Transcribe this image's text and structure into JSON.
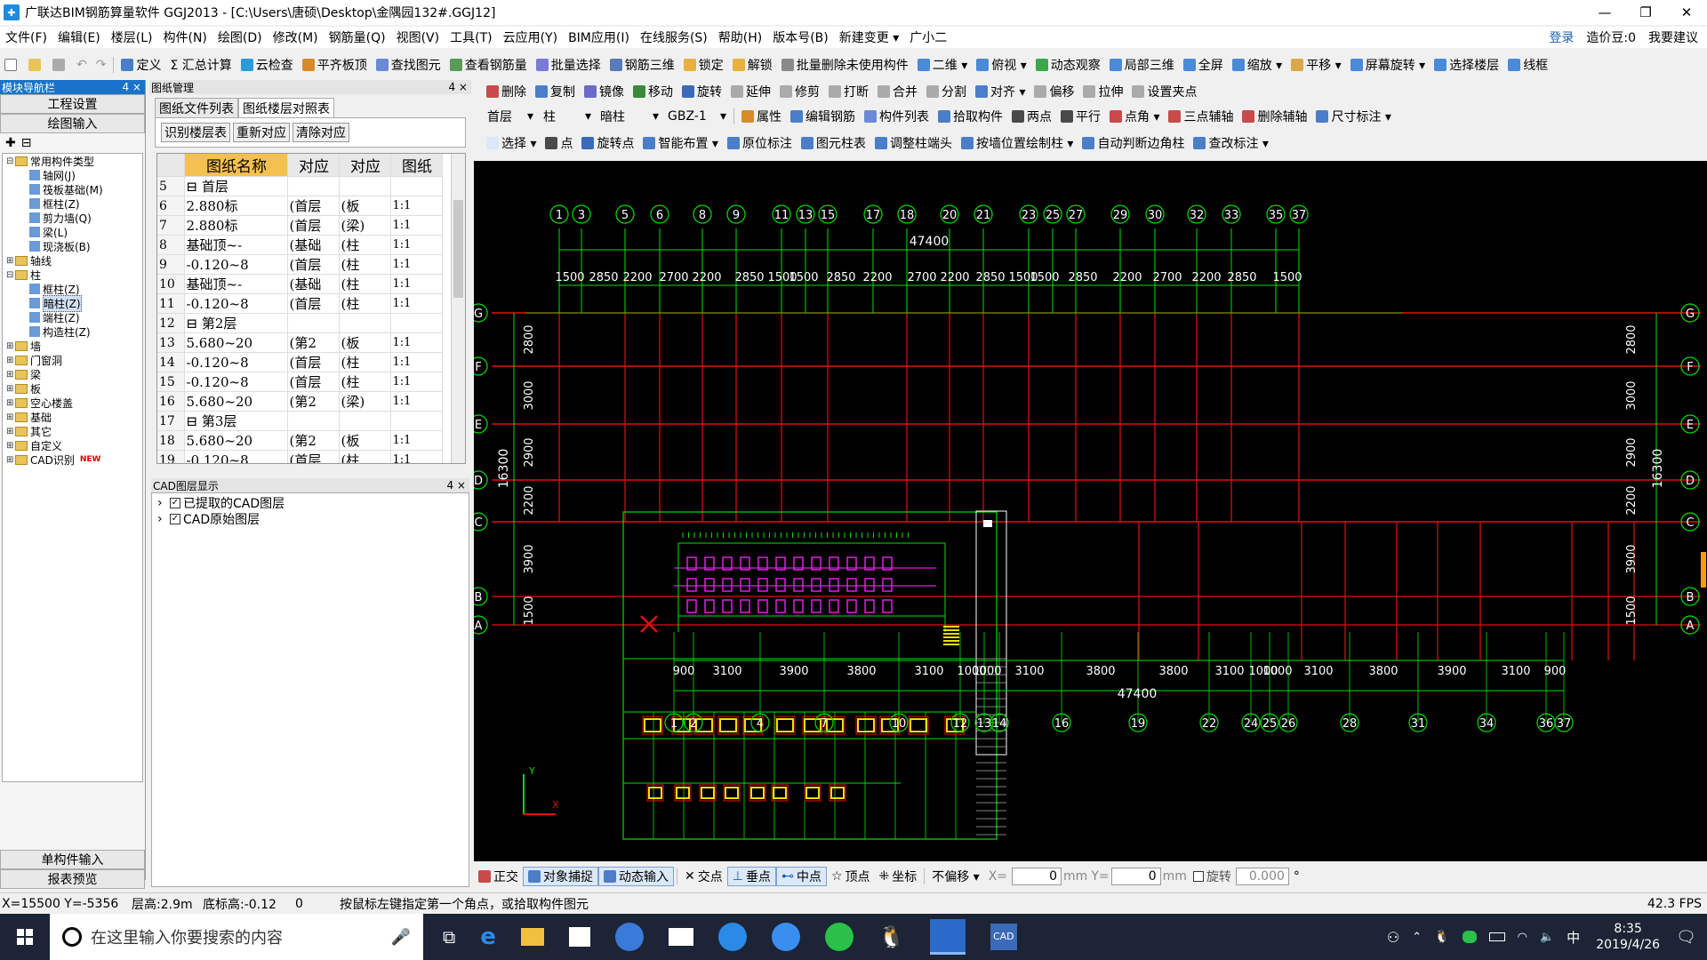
{
  "window": {
    "title": "广联达BIM钢筋算量软件 GGJ2013 - [C:\\Users\\唐硕\\Desktop\\金隅园132#.GGJ12]",
    "minimize": "—",
    "maximize": "❐",
    "close": "✕"
  },
  "menu": {
    "items": [
      "文件(F)",
      "编辑(E)",
      "楼层(L)",
      "构件(N)",
      "绘图(D)",
      "修改(M)",
      "钢筋量(Q)",
      "视图(V)",
      "工具(T)",
      "云应用(Y)",
      "BIM应用(I)",
      "在线服务(S)",
      "帮助(H)",
      "版本号(B)",
      "新建变更 ▾",
      "广小二"
    ],
    "login": "登录",
    "cost_beans": "造价豆:0",
    "suggest": "我要建议"
  },
  "toolbar1": [
    "定义",
    "Σ 汇总计算",
    "云检查",
    "平齐板顶",
    "查找图元",
    "查看钢筋量",
    "批量选择",
    "钢筋三维",
    "锁定",
    "解锁",
    "批量删除未使用构件",
    "二维 ▾",
    "俯视 ▾",
    "动态观察",
    "局部三维",
    "全屏",
    "缩放 ▾",
    "平移 ▾",
    "屏幕旋转 ▾",
    "选择楼层",
    "线框"
  ],
  "nav_panel": {
    "title": "模块导航栏",
    "pin": "4 ×",
    "buttons": [
      "工程设置",
      "绘图输入"
    ],
    "tree": [
      {
        "label": "常用构件类型",
        "level": 0,
        "type": "folder"
      },
      {
        "label": "轴网(J)",
        "level": 2,
        "type": "item"
      },
      {
        "label": "筏板基础(M)",
        "level": 2,
        "type": "item"
      },
      {
        "label": "框柱(Z)",
        "level": 2,
        "type": "item"
      },
      {
        "label": "剪力墙(Q)",
        "level": 2,
        "type": "item"
      },
      {
        "label": "梁(L)",
        "level": 2,
        "type": "item"
      },
      {
        "label": "现浇板(B)",
        "level": 2,
        "type": "item"
      },
      {
        "label": "轴线",
        "level": 0,
        "type": "folder"
      },
      {
        "label": "柱",
        "level": 0,
        "type": "folder"
      },
      {
        "label": "框柱(Z)",
        "level": 2,
        "type": "item"
      },
      {
        "label": "暗柱(Z)",
        "level": 2,
        "type": "item"
      },
      {
        "label": "端柱(Z)",
        "level": 2,
        "type": "item"
      },
      {
        "label": "构造柱(Z)",
        "level": 2,
        "type": "item"
      },
      {
        "label": "墙",
        "level": 0,
        "type": "folder"
      },
      {
        "label": "门窗洞",
        "level": 0,
        "type": "folder"
      },
      {
        "label": "梁",
        "level": 0,
        "type": "folder"
      },
      {
        "label": "板",
        "level": 0,
        "type": "folder"
      },
      {
        "label": "空心楼盖",
        "level": 0,
        "type": "folder"
      },
      {
        "label": "基础",
        "level": 0,
        "type": "folder"
      },
      {
        "label": "其它",
        "level": 0,
        "type": "folder"
      },
      {
        "label": "自定义",
        "level": 0,
        "type": "folder"
      },
      {
        "label": "CAD识别",
        "level": 0,
        "type": "folder",
        "badge": "NEW"
      }
    ],
    "bottom_buttons": [
      "单构件输入",
      "报表预览"
    ]
  },
  "drawing_panel": {
    "title": "图纸管理",
    "pin": "4 ×",
    "tabs": [
      "图纸文件列表",
      "图纸楼层对照表"
    ],
    "buttons": [
      "识别楼层表",
      "重新对应",
      "清除对应"
    ],
    "columns": [
      "图纸名称",
      "对应",
      "对应",
      "图纸"
    ],
    "rows": [
      [
        "5",
        "⊟ 首层",
        "",
        "",
        ""
      ],
      [
        "6",
        "  2.880标",
        "(首层",
        "(板",
        "1:1"
      ],
      [
        "7",
        "  2.880标",
        "(首层",
        "(梁)",
        "1:1"
      ],
      [
        "8",
        "  基础顶~-",
        "(基础",
        "(柱",
        "1:1"
      ],
      [
        "9",
        "  -0.120~8",
        "(首层",
        "(柱",
        "1:1"
      ],
      [
        "10",
        "  基础顶~-",
        "(基础",
        "(柱",
        "1:1"
      ],
      [
        "11",
        "  -0.120~8",
        "(首层",
        "(柱",
        "1:1"
      ],
      [
        "12",
        "⊟ 第2层",
        "",
        "",
        ""
      ],
      [
        "13",
        "  5.680~20",
        "(第2",
        "(板",
        "1:1"
      ],
      [
        "14",
        "  -0.120~8",
        "(首层",
        "(柱",
        "1:1"
      ],
      [
        "15",
        "  -0.120~8",
        "(首层",
        "(柱",
        "1:1"
      ],
      [
        "16",
        "  5.680~20",
        "(第2",
        "(梁)",
        "1:1"
      ],
      [
        "17",
        "⊟ 第3层",
        "",
        "",
        ""
      ],
      [
        "18",
        "  5.680~20",
        "(第2",
        "(板",
        "1:1"
      ],
      [
        "19",
        "  -0.120~8",
        "(首层",
        "(柱",
        "1:1"
      ],
      [
        "20",
        "  -0.120~8",
        "(首层",
        "(柱",
        "1:1"
      ],
      [
        "21",
        "  5.680~20",
        "(第2",
        "(梁)",
        "1:1"
      ]
    ]
  },
  "cad_layers": {
    "title": "CAD图层显示",
    "pin": "4 ×",
    "items": [
      "已提取的CAD图层",
      "CAD原始图层"
    ]
  },
  "edit_toolbar": [
    "删除",
    "复制",
    "镜像",
    "移动",
    "旋转",
    "延伸",
    "修剪",
    "打断",
    "合并",
    "分割",
    "对齐 ▾",
    "偏移",
    "拉伸",
    "设置夹点"
  ],
  "prop_toolbar": {
    "floor": "首层",
    "type": "柱",
    "subtype": "暗柱",
    "component": "GBZ-1",
    "buttons": [
      "属性",
      "编辑钢筋",
      "构件列表",
      "拾取构件",
      "两点",
      "平行",
      "点角 ▾",
      "三点辅轴",
      "删除辅轴",
      "尺寸标注 ▾"
    ]
  },
  "draw_toolbar": [
    "选择 ▾",
    "点",
    "旋转点",
    "智能布置 ▾",
    "原位标注",
    "图元柱表",
    "调整柱端头",
    "按墙位置绘制柱 ▾",
    "自动判断边角柱",
    "查改标注 ▾"
  ],
  "cad": {
    "top_axes": [
      "1",
      "3",
      "5",
      "6",
      "8",
      "9",
      "11",
      "13",
      "15",
      "17",
      "18",
      "20",
      "21",
      "23",
      "25",
      "27",
      "29",
      "30",
      "32",
      "33",
      "35",
      "37"
    ],
    "top_total": "47400",
    "top_dims": [
      "1500",
      "2850",
      "2200",
      "2700",
      "2200",
      "2850",
      "1500",
      "1500",
      "2850",
      "2200",
      "2700",
      "2200",
      "2850",
      "1500",
      "1500",
      "2850",
      "2200",
      "2700",
      "2200",
      "2850",
      "1500"
    ],
    "bottom_axes": [
      "1",
      "2",
      "4",
      "7",
      "10",
      "12",
      "13",
      "14",
      "16",
      "19",
      "22",
      "24",
      "25",
      "26",
      "28",
      "31",
      "34",
      "36",
      "37"
    ],
    "bottom_total": "47400",
    "bottom_dims": [
      "900",
      "3100",
      "3900",
      "3800",
      "3100",
      "1000",
      "1000",
      "3100",
      "3800",
      "3800",
      "3100",
      "1000",
      "1000",
      "3100",
      "3800",
      "3900",
      "3100",
      "900"
    ],
    "row_axes": [
      "G",
      "F",
      "E",
      "D",
      "C",
      "B",
      "A"
    ],
    "left_dims": [
      "2800",
      "3000",
      "2900",
      "2200",
      "3900",
      "1500"
    ],
    "right_dims": [
      "2800",
      "3000",
      "2900",
      "2200",
      "3900",
      "1500"
    ],
    "total_height": "16300",
    "ucs_x": "X",
    "ucs_y": "Y"
  },
  "snap_bar": {
    "items": [
      "正交",
      "对象捕捉",
      "动态输入",
      "交点",
      "垂点",
      "中点",
      "顶点",
      "坐标"
    ],
    "offset_mode": "不偏移 ▾",
    "x_label": "X=",
    "x_value": "0",
    "mm1": "mm",
    "y_label": "Y=",
    "y_value": "0",
    "mm2": "mm",
    "rotate_label": "旋转",
    "rotate_value": "0.000",
    "degree": "°"
  },
  "status": {
    "coords": "X=15500  Y=-5356",
    "floor_height": "层高:2.9m",
    "base_height": "底标高:-0.12",
    "zero": "0",
    "hint": "按鼠标左键指定第一个角点，或拾取构件图元",
    "fps": "42.3 FPS"
  },
  "taskbar": {
    "search_placeholder": "在这里输入你要搜索的内容",
    "time": "8:35",
    "date": "2019/4/26",
    "ime": "中"
  }
}
